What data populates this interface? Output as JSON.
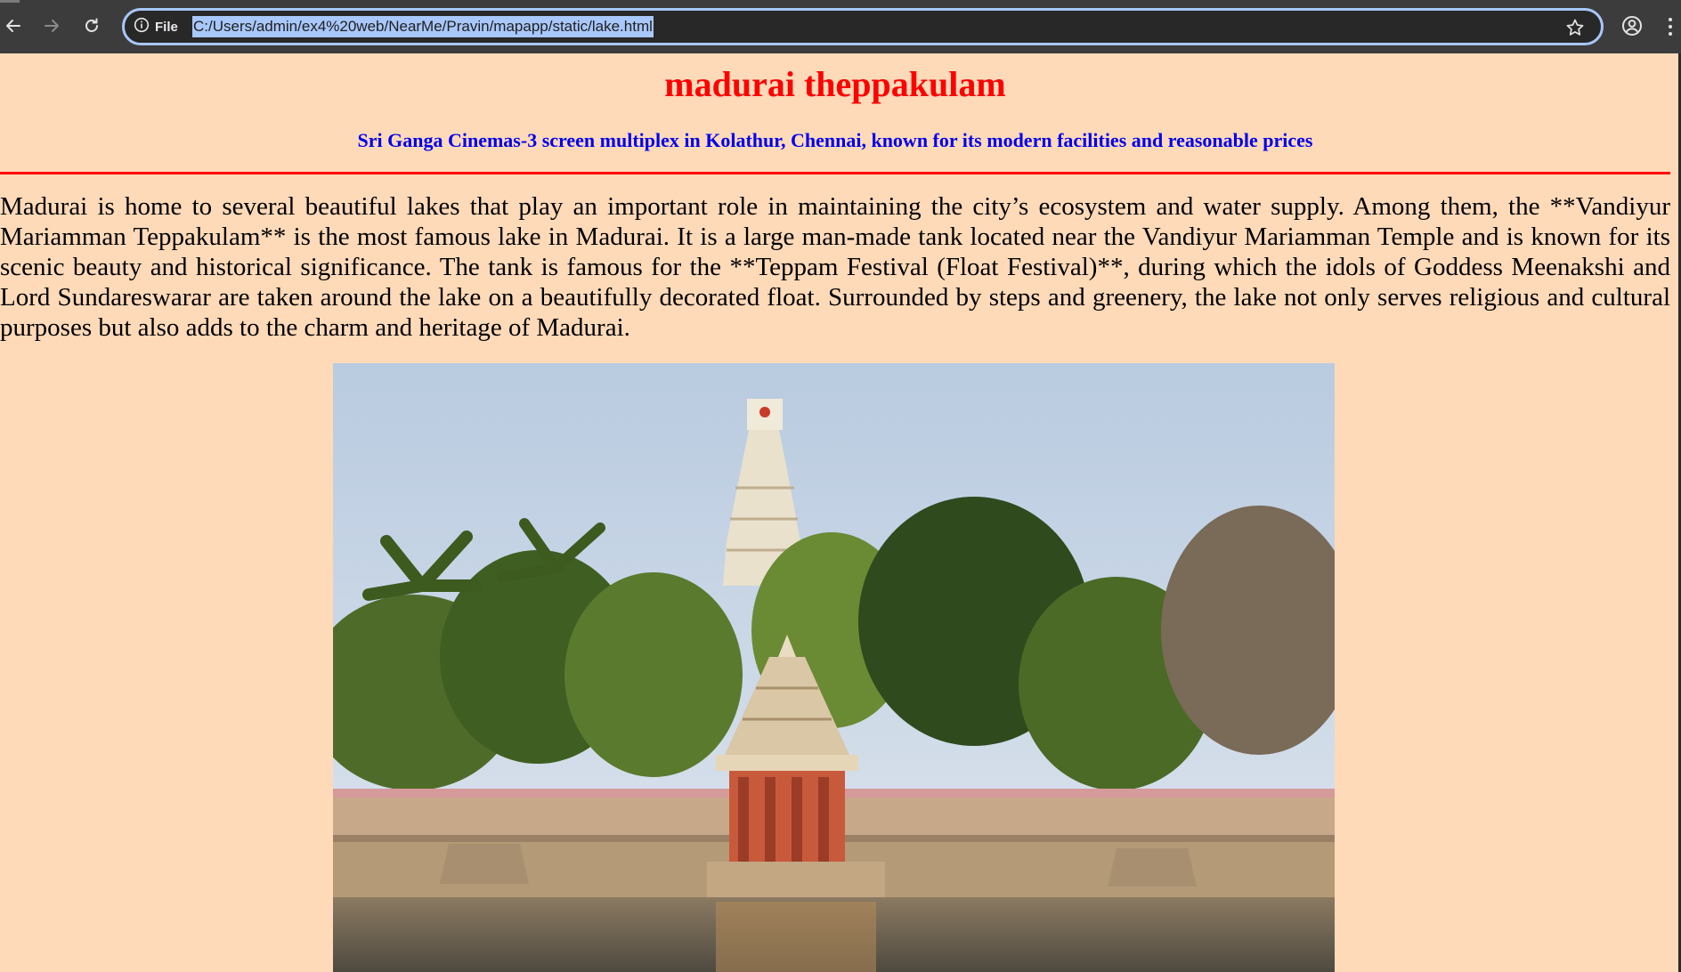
{
  "browser": {
    "site_info_label": "File",
    "url": "C:/Users/admin/ex4%20web/NearMe/Pravin/mapapp/static/lake.html",
    "icons": [
      "back-arrow-icon",
      "forward-arrow-icon",
      "reload-icon",
      "info-icon",
      "star-icon",
      "profile-icon",
      "kebab-menu-icon"
    ]
  },
  "page": {
    "title": "madurai theppakulam",
    "subtitle": "Sri Ganga Cinemas-3 screen multiplex in Kolathur, Chennai, known for its modern facilities and reasonable prices",
    "description": "Madurai is home to several beautiful lakes that play an important role in maintaining the city’s ecosystem and water supply. Among them, the **Vandiyur Mariamman Teppakulam** is the most famous lake in Madurai. It is a large man-made tank located near the Vandiyur Mariamman Temple and is known for its scenic beauty and historical significance. The tank is famous for the **Teppam Festival (Float Festival)**, during which the idols of Goddess Meenakshi and Lord Sundareswarar are taken around the lake on a beautifully decorated float. Surrounded by steps and greenery, the lake not only serves religious and cultural purposes but also adds to the charm and heritage of Madurai."
  },
  "colors": {
    "page_background": "#ffdab9",
    "title": "#ff0000",
    "subtitle": "#0000ee",
    "divider": "#ff0000",
    "chrome": "#3c3c3c",
    "url_selection": "#a8c7fa"
  }
}
